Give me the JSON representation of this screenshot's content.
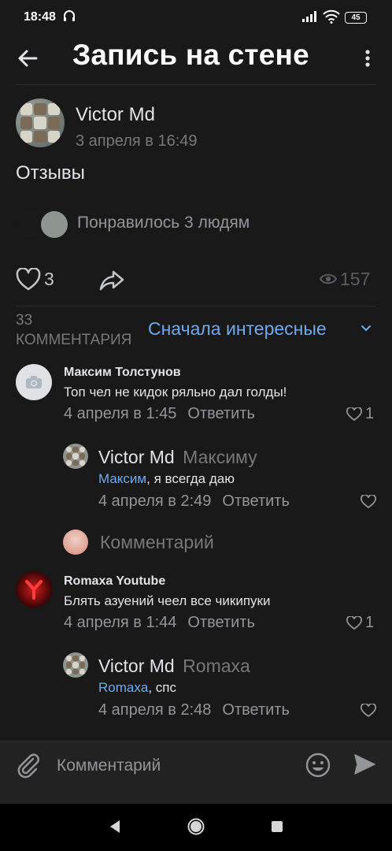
{
  "status": {
    "time": "18:48",
    "battery": "45"
  },
  "header": {
    "title": "Запись на стене"
  },
  "post": {
    "author": "Victor Md",
    "date": "3 апреля в 16:49",
    "text": "Отзывы",
    "liked_by": "Понравилось 3 людям",
    "likes": "3",
    "views": "157"
  },
  "comments_header": {
    "count_label": "33 КОММЕНТАРИЯ",
    "sort_label": "Сначала интересные"
  },
  "comments": [
    {
      "author": "Максим Толстунов",
      "text": "Топ чел не кидок ряльно дал голды!",
      "date": "4 апреля в 1:45",
      "reply_label": "Ответить",
      "likes": "1",
      "replies": [
        {
          "author": "Victor Md",
          "reply_to": "Максиму",
          "mention": "Максим",
          "text": ", я всегда даю",
          "date": "4 апреля в 2:49",
          "reply_label": "Ответить"
        }
      ],
      "comment_placeholder": "Комментарий"
    },
    {
      "author": "Romaxa Youtube",
      "text": "Блять азуений чеел все чикипуки",
      "date": "4 апреля в 1:44",
      "reply_label": "Ответить",
      "likes": "1",
      "replies": [
        {
          "author": "Victor Md",
          "reply_to": "Romaxa",
          "mention": "Romaxa",
          "text": ", спс",
          "date": "4 апреля в 2:48",
          "reply_label": "Ответить"
        }
      ]
    }
  ],
  "composer": {
    "placeholder": "Комментарий"
  },
  "colors": {
    "background": "#19191a",
    "accent": "#71aaeb",
    "text": "#e1e3e6",
    "secondary": "#939598"
  },
  "icons": [
    "back-arrow-icon",
    "more-vertical-icon",
    "heart-icon",
    "share-icon",
    "eye-icon",
    "chevron-down-icon",
    "camera-icon",
    "paperclip-icon",
    "smile-icon",
    "send-icon"
  ]
}
